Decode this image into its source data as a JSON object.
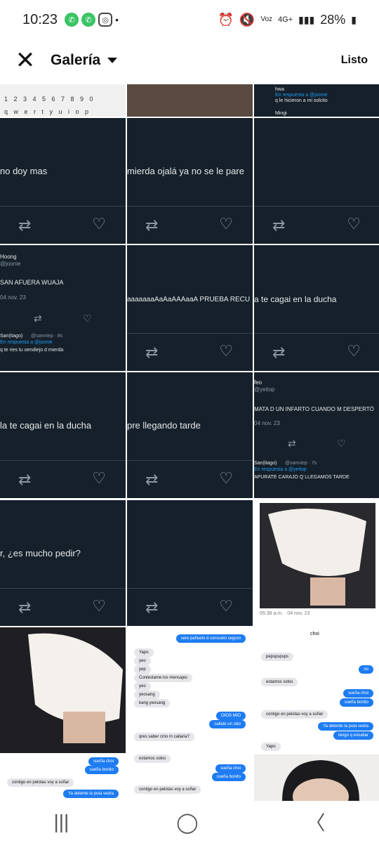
{
  "status": {
    "time": "10:23",
    "battery": "28%",
    "network": "4G+",
    "voz": "Voz"
  },
  "appbar": {
    "title": "Galería",
    "done": "Listo"
  },
  "tweets": {
    "t1": "no doy mas",
    "t2": "mierda ojalá ya no se le pare",
    "t3_name": "Hoong",
    "t3_handle": "@joonie",
    "t3_text": "SAN AFUERA WUAJA",
    "t3_date": "04 nov. 23",
    "t3_reply_name": "San(tiago)",
    "t3_reply_meta": "@sanniep · 8s",
    "t3_reply_to": "En respuesta a @joonie",
    "t3_reply_text": "q te ries tu oendiejo d mierda",
    "t4": "aaaaaaaAaAaAAAaaA PRUEBA RECU",
    "t5": "a te cagai en la ducha",
    "t6": "la te cagai en la ducha",
    "t7": "pre llegando tarde",
    "t8_name": "feo",
    "t8_handle": "@yeitop",
    "t8_text": "MATA D UN INFARTO CUANDO M DESPERTÓ",
    "t8_date": "04 nov. 23",
    "t8_reply_name": "San(tiago)",
    "t8_reply_meta": "@sanniep · 7s",
    "t8_reply_to": "En respuesta a @yeitop",
    "t8_reply_text": "APURATE CARAJO Q LLEGAMOS TARDE",
    "t9": "r, ¿es mucho pedir?",
    "top_right_name": "hwa",
    "top_right_reply": "En respuesta a @joonie",
    "top_right_text": "q le hicieron a mi solcito",
    "top_right_name2": "Mingi",
    "photo_caption": "05:38 a.m. · 04 nov. 23"
  },
  "chat1": {
    "blue": [
      "sere pañuelo d consuelo seguro",
      "OIOS MIO",
      "callate un rato"
    ],
    "grey": [
      "Yapo",
      "yeo",
      "yep",
      "Contestame los mensajes",
      "yeo",
      "yeosang",
      "kang yeosang",
      "qres saber cmo m callaria?"
    ]
  },
  "chat2": {
    "header": "choi",
    "grey": [
      "pepspspsps",
      "estamos solos",
      "contigo en pelotas voy a soñar",
      "Yapo"
    ],
    "blue": [
      "no",
      "sueña choi",
      "sueña bonito",
      "Ya detente la puta vedra",
      "tengo q estudiar"
    ]
  },
  "chat3": {
    "blue": [
      "sueña choi",
      "sueña bonito",
      "Ya detente la puta vedra"
    ],
    "grey": [
      "contigo en pelotas voy a soñar"
    ]
  },
  "chat4": {
    "blue": [
      "sueña choi",
      "sueña bonito"
    ],
    "grey": [
      "estamos solos",
      "contigo en pelotas voy a soñar"
    ]
  },
  "keyboard": {
    "row": "1 2 3 4 5 6 7 8 9 0",
    "row2": "q w e r t y u i o p"
  },
  "colors": {
    "tweet_bg": "#15202b",
    "blue": "#1e7cf2"
  },
  "nav": {
    "recent": "|||",
    "home": "◯",
    "back": "〈"
  }
}
